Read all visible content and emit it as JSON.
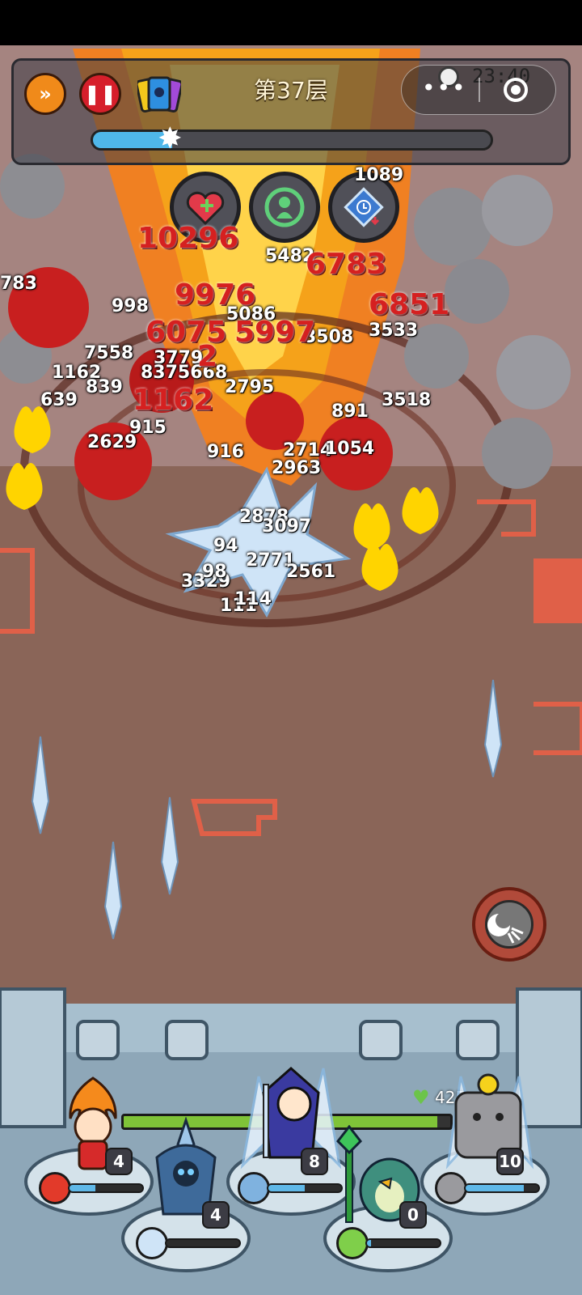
{
  "header": {
    "floor_title": "第37层",
    "clock_time": "23:40",
    "progress": 0.2,
    "buttons": {
      "fast_forward_icon": "fast-forward-icon",
      "pause_icon": "pause-icon",
      "cards_icon": "card-deck-icon",
      "menu_icon": "more-dots-icon",
      "close_icon": "target-close-icon"
    }
  },
  "skills": [
    {
      "name": "heal-boost-icon"
    },
    {
      "name": "summon-icon"
    },
    {
      "name": "time-down-icon"
    }
  ],
  "damage_numbers": {
    "white": [
      "1089",
      "5482",
      "783",
      "998",
      "5086",
      "3508",
      "3533",
      "7558",
      "3779",
      "1162",
      "8375668",
      "839",
      "2795",
      "639",
      "915",
      "3518",
      "891",
      "2629",
      "916",
      "2714",
      "1054",
      "2963",
      "2878",
      "3097",
      "94",
      "2771",
      "3329",
      "98",
      "2561",
      "111",
      "114"
    ],
    "red": [
      "10296",
      "6783",
      "9976",
      "6851",
      "6075",
      "5997",
      "2",
      "1162"
    ]
  },
  "castle": {
    "hp_value": "425",
    "hp_fraction": 0.96
  },
  "heroes": [
    {
      "name": "fire-girl",
      "level": "4",
      "energy": 0.35
    },
    {
      "name": "ice-knight",
      "level": "4",
      "energy": 0.0
    },
    {
      "name": "ice-mage",
      "level": "8",
      "energy": 0.5
    },
    {
      "name": "green-bird",
      "level": "0",
      "energy": 0.05
    },
    {
      "name": "stone-golem",
      "level": "10",
      "energy": 0.8
    }
  ],
  "action_button": {
    "icon": "shockwave-icon"
  },
  "colors": {
    "fire": "#f5a21a",
    "floor": "#8a6558",
    "wall": "#a7bfce",
    "progress": "#4fb7ea",
    "hp": "#7fc338"
  }
}
